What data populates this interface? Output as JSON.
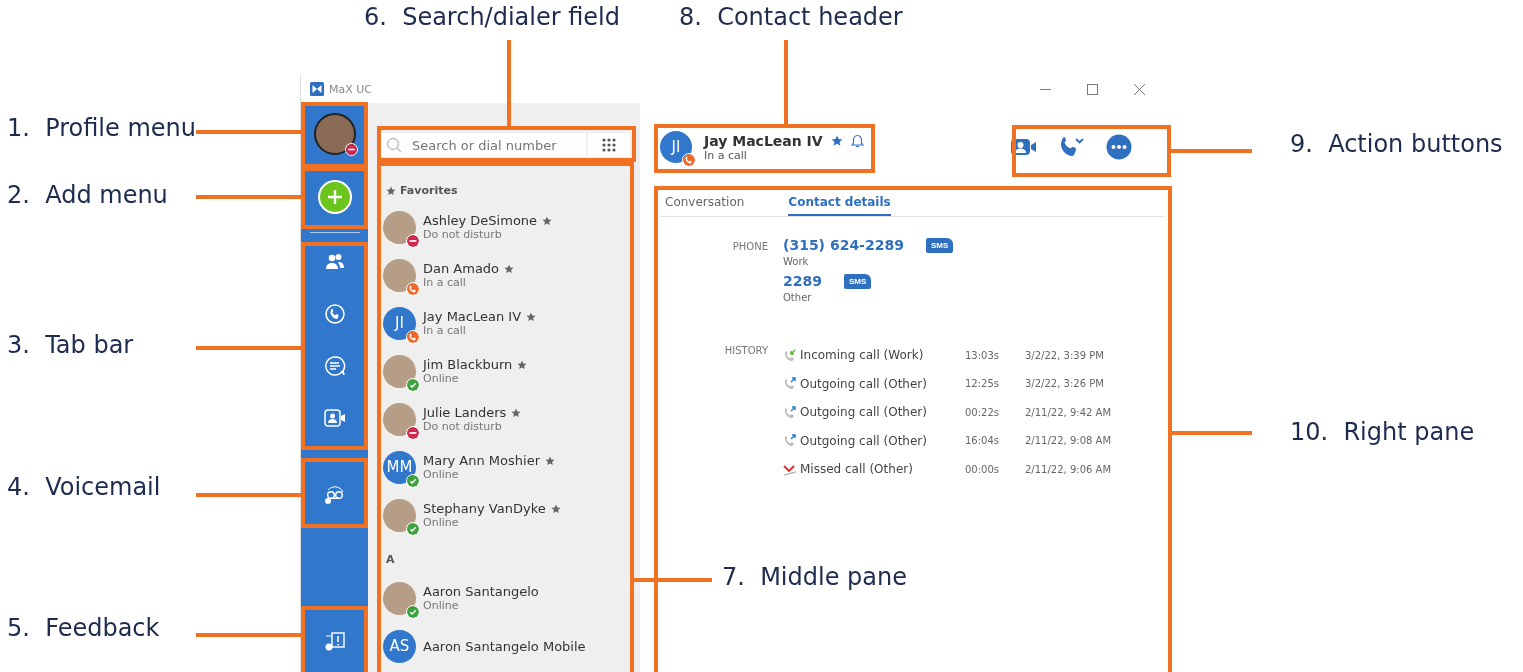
{
  "window": {
    "title": "MaX UC"
  },
  "rail": {
    "profile": {
      "presence": {
        "kind": "dnd",
        "color": "#d0284d"
      }
    },
    "tabs": [
      {
        "kind": "contacts"
      },
      {
        "kind": "calls"
      },
      {
        "kind": "chat"
      },
      {
        "kind": "meetings"
      }
    ]
  },
  "search": {
    "placeholder": "Search or dial number"
  },
  "contact_sections": [
    {
      "header": "Favorites",
      "kind": "favorites",
      "contacts": [
        {
          "name": "Ashley DeSimone",
          "status": "Do not disturb",
          "presence": {
            "kind": "dnd",
            "color": "#d0284d"
          },
          "kind": "photo",
          "favorite": true
        },
        {
          "name": "Dan Amado",
          "status": "In a call",
          "presence": {
            "kind": "call",
            "color": "#ee6a28"
          },
          "kind": "photo",
          "favorite": true
        },
        {
          "name": "Jay MacLean IV",
          "status": "In a call",
          "presence": {
            "kind": "call",
            "color": "#ee6a28"
          },
          "kind": "initials",
          "initials": "JI",
          "favorite": true
        },
        {
          "name": "Jim Blackburn",
          "status": "Online",
          "presence": {
            "kind": "online",
            "color": "#3ca33c"
          },
          "kind": "photo",
          "favorite": true
        },
        {
          "name": "Julie Landers",
          "status": "Do not disturb",
          "presence": {
            "kind": "dnd",
            "color": "#d0284d"
          },
          "kind": "photo",
          "favorite": true
        },
        {
          "name": "Mary Ann Moshier",
          "status": "Online",
          "presence": {
            "kind": "online",
            "color": "#3ca33c"
          },
          "kind": "initials",
          "initials": "MM",
          "favorite": true
        },
        {
          "name": "Stephany VanDyke",
          "status": "Online",
          "presence": {
            "kind": "online",
            "color": "#3ca33c"
          },
          "kind": "photo",
          "favorite": true
        }
      ]
    },
    {
      "header": "A",
      "kind": "letter",
      "contacts": [
        {
          "name": "Aaron Santangelo",
          "status": "Online",
          "presence": {
            "kind": "online",
            "color": "#3ca33c"
          },
          "kind": "photo",
          "favorite": false
        },
        {
          "name": "Aaron Santangelo Mobile",
          "kind": "initials",
          "initials": "AS",
          "favorite": false
        }
      ]
    }
  ],
  "contact_header": {
    "name": "Jay MacLean IV",
    "status": "In a call",
    "initials": "JI",
    "presence": {
      "kind": "call",
      "color": "#ee6a28"
    },
    "favorite": true
  },
  "detail_tabs": [
    {
      "label": "Conversation",
      "selected": false
    },
    {
      "label": "Contact details",
      "selected": true
    }
  ],
  "phone_label": "PHONE",
  "phones": [
    {
      "number": "(315) 624-2289",
      "type": "Work",
      "sms": "SMS"
    },
    {
      "number": "2289",
      "type": "Other",
      "sms": "SMS"
    }
  ],
  "history_label": "HISTORY",
  "history": [
    {
      "kind": "incoming",
      "label": "Incoming call (Work)",
      "duration": "13:03s",
      "time": "3/2/22, 3:39 PM"
    },
    {
      "kind": "outgoing",
      "label": "Outgoing call (Other)",
      "duration": "12:25s",
      "time": "3/2/22, 3:26 PM"
    },
    {
      "kind": "outgoing",
      "label": "Outgoing call (Other)",
      "duration": "00:22s",
      "time": "2/11/22, 9:42 AM"
    },
    {
      "kind": "outgoing",
      "label": "Outgoing call (Other)",
      "duration": "16:04s",
      "time": "2/11/22, 9:08 AM"
    },
    {
      "kind": "missed",
      "label": "Missed call (Other)",
      "duration": "00:00s",
      "time": "2/11/22, 9:06 AM"
    }
  ],
  "annotations": [
    {
      "number": "6.",
      "label": "Search/dialer field"
    },
    {
      "number": "8.",
      "label": "Contact header"
    },
    {
      "number": "1.",
      "label": "Profile menu"
    },
    {
      "number": "9.",
      "label": "Action buttons"
    },
    {
      "number": "2.",
      "label": "Add menu"
    },
    {
      "number": "3.",
      "label": "Tab bar"
    },
    {
      "number": "10.",
      "label": "Right pane"
    },
    {
      "number": "4.",
      "label": "Voicemail"
    },
    {
      "number": "7.",
      "label": "Middle pane"
    },
    {
      "number": "5.",
      "label": "Feedback"
    }
  ]
}
